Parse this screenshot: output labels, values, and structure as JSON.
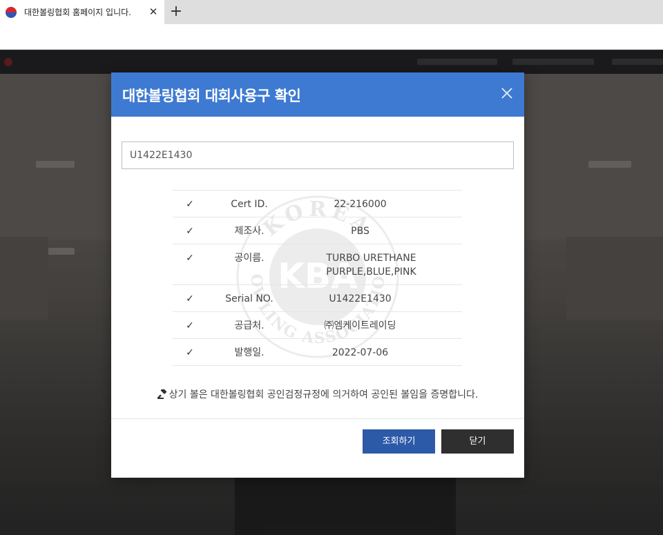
{
  "browser": {
    "tab_title": "대한볼링협회 홈페이지 입니다.",
    "tab_close": "✕",
    "new_tab": "+"
  },
  "modal": {
    "title": "대한볼링협회 대회사용구 확인",
    "accent_color": "#3e7ad2",
    "serial_input_value": "U1422E1430",
    "watermark": {
      "top_text": "KOREA",
      "center_text": "KBA",
      "bottom_text": "BOWLING ASSOCIATION"
    },
    "rows": [
      {
        "check": "✓",
        "label": "Cert ID.",
        "value": "22-216000"
      },
      {
        "check": "✓",
        "label": "제조사.",
        "value": "PBS"
      },
      {
        "check": "✓",
        "label": "공이름.",
        "value": "TURBO URETHANE PURPLE,BLUE,PINK"
      },
      {
        "check": "✓",
        "label": "Serial NO.",
        "value": "U1422E1430"
      },
      {
        "check": "✓",
        "label": "공급처.",
        "value": "㈜엠케이트레이딩"
      },
      {
        "check": "✓",
        "label": "발행일.",
        "value": "2022-07-06"
      }
    ],
    "notice": "상기 볼은 대한볼링협회 공인검정규정에 의거하여 공인된 볼임을 증명합니다.",
    "buttons": {
      "search": "조회하기",
      "close": "닫기"
    }
  }
}
